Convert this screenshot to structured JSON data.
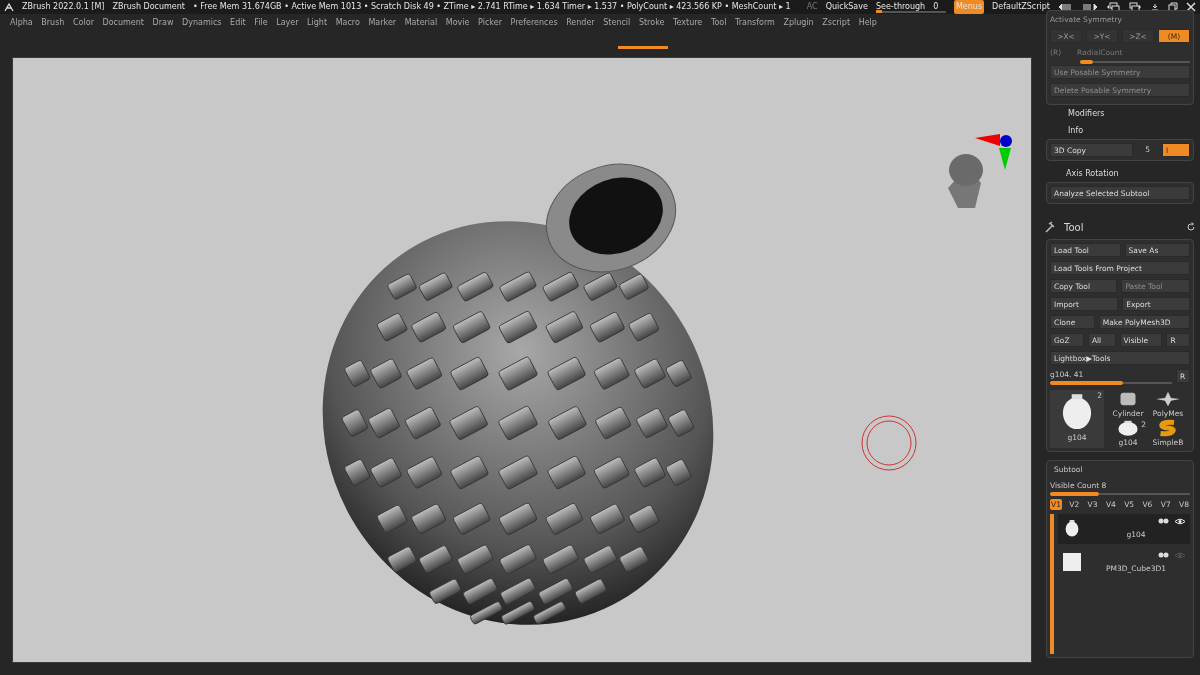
{
  "title_bar": {
    "app_title": "ZBrush 2022.0.1 [M]",
    "document": "ZBrush Document",
    "stats": "• Free Mem 31.674GB • Active Mem 1013 • Scratch Disk 49 •  ZTime ▸ 2.741 RTime ▸ 1.634 Timer ▸ 1.537 • PolyCount ▸ 423.566 KP  • MeshCount ▸ 1",
    "ac": "AC",
    "quicksave": "QuickSave",
    "see_through": {
      "label": "See-through",
      "value": "0",
      "level": 0.05
    },
    "menus": {
      "label": "Menus",
      "on": true
    },
    "script_name": "DefaultZScript"
  },
  "menu_bar": [
    "Alpha",
    "Brush",
    "Color",
    "Document",
    "Draw",
    "Dynamics",
    "Edit",
    "File",
    "Layer",
    "Light",
    "Macro",
    "Marker",
    "Material",
    "Movie",
    "Picker",
    "Preferences",
    "Render",
    "Stencil",
    "Stroke",
    "Texture",
    "Tool",
    "Transform",
    "Zplugin",
    "Zscript",
    "Help"
  ],
  "symmetry": {
    "title": "Activate Symmetry",
    "axes": [
      {
        "label": ">X<",
        "on": false
      },
      {
        "label": ">Y<",
        "on": false
      },
      {
        "label": ">Z<",
        "on": false
      },
      {
        "label": "(M)",
        "on": true
      }
    ],
    "radial": {
      "key": "(R)",
      "label": "RadialCount",
      "level": 0.12
    },
    "buttons": [
      {
        "label": "Use Posable Symmetry",
        "disabled": true
      },
      {
        "label": "Delete Posable Symmetry",
        "disabled": true
      }
    ]
  },
  "sections": [
    {
      "label": "Modifiers"
    },
    {
      "label": "Info"
    }
  ],
  "copy_3d": {
    "label": "3D Copy",
    "value": "5",
    "toggle": {
      "label": "I",
      "on": true
    }
  },
  "axis_rotation": {
    "label": "Axis Rotation",
    "button": "Analyze Selected Subtool"
  },
  "tool": {
    "title": "Tool",
    "button_rows": [
      [
        {
          "label": "Load Tool",
          "disabled": false
        },
        {
          "label": "Save As",
          "disabled": false
        }
      ],
      [
        {
          "label": "Load Tools From Project",
          "disabled": false
        }
      ],
      [
        {
          "label": "Copy Tool",
          "disabled": false
        },
        {
          "label": "Paste Tool",
          "disabled": true
        }
      ],
      [
        {
          "label": "Import",
          "disabled": false
        },
        {
          "label": "Export",
          "disabled": false
        }
      ],
      [
        {
          "label": "Clone",
          "disabled": false
        },
        {
          "label": "Make PolyMesh3D",
          "disabled": false
        }
      ],
      [
        {
          "label": "GoZ",
          "disabled": false
        },
        {
          "label": "All",
          "disabled": false
        },
        {
          "label": "Visible",
          "disabled": false
        },
        {
          "label": "R",
          "disabled": false
        }
      ],
      [
        {
          "label": "Lightbox▶Tools",
          "disabled": false
        }
      ]
    ],
    "slider": {
      "label": "g104. 41",
      "level": 0.6,
      "reset": "R"
    },
    "thumbnails": [
      {
        "kind": "vase",
        "label": "g104",
        "count": "2"
      },
      {
        "kind": "cylinder",
        "label": "Cylinder"
      },
      {
        "kind": "star",
        "label": "PolyMes"
      },
      {
        "kind": "vase",
        "label": "g104",
        "count": "2"
      },
      {
        "kind": "snake",
        "label": "SimpleB"
      }
    ]
  },
  "subtool": {
    "title": "Subtool",
    "visible_count": {
      "label": "Visible Count 8",
      "level": 0.35
    },
    "versions": [
      {
        "label": "V1",
        "selected": true
      },
      {
        "label": "V2",
        "selected": false
      },
      {
        "label": "V3",
        "selected": false
      },
      {
        "label": "V4",
        "selected": false
      },
      {
        "label": "V5",
        "selected": false
      },
      {
        "label": "V6",
        "selected": false
      },
      {
        "label": "V7",
        "selected": false
      },
      {
        "label": "V8",
        "selected": false
      }
    ],
    "items": [
      {
        "kind": "vase",
        "name": "g104",
        "selected": true,
        "visible": true
      },
      {
        "kind": "cube",
        "name": "PM3D_Cube3D1",
        "selected": false,
        "visible": false
      }
    ]
  }
}
